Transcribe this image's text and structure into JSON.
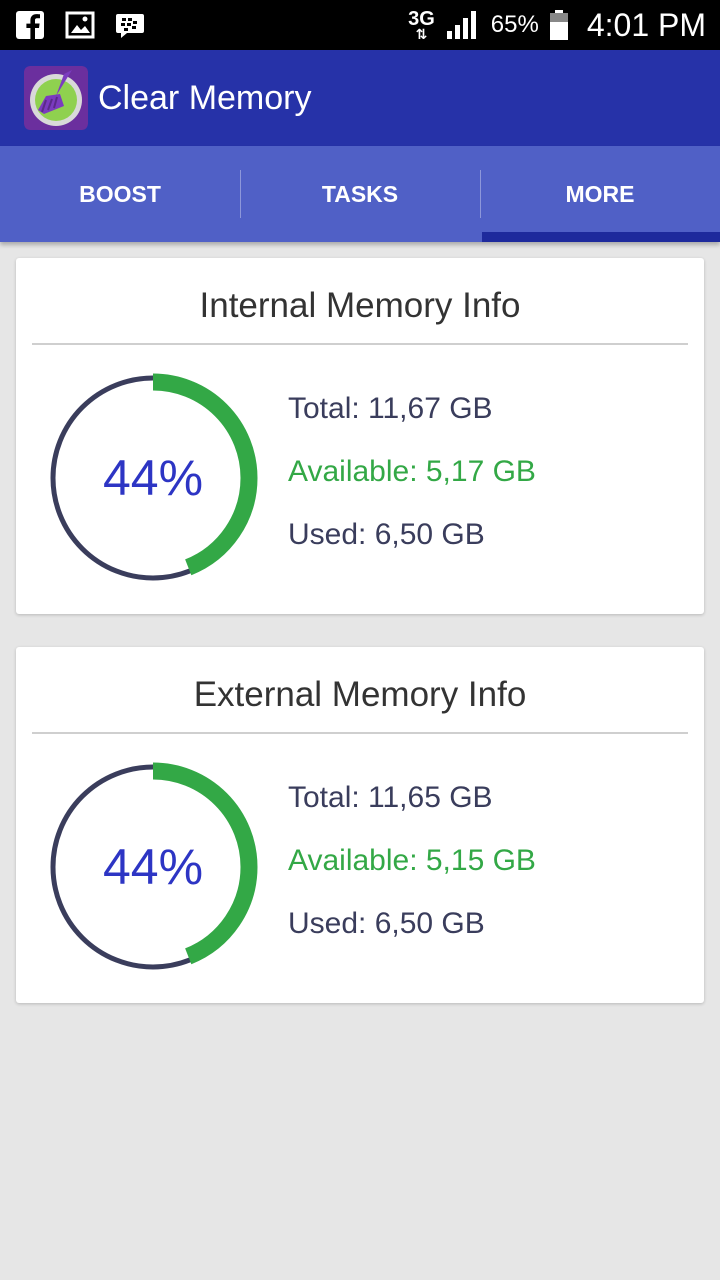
{
  "status_bar": {
    "network_type": "3G",
    "battery_percent": "65%",
    "time": "4:01 PM",
    "icons": [
      "facebook-icon",
      "gallery-icon",
      "bbm-icon",
      "data-arrows-icon",
      "signal-icon",
      "battery-icon"
    ]
  },
  "app": {
    "title": "Clear Memory",
    "logo_icon": "broom-icon"
  },
  "tabs": [
    {
      "label": "BOOST",
      "active": false
    },
    {
      "label": "TASKS",
      "active": false
    },
    {
      "label": "MORE",
      "active": true
    }
  ],
  "internal": {
    "title": "Internal Memory Info",
    "percent_label": "44%",
    "used_fraction": 0.44,
    "total": "Total: 11,67 GB",
    "available": "Available: 5,17 GB",
    "used": "Used: 6,50 GB"
  },
  "external": {
    "title": "External Memory Info",
    "percent_label": "44%",
    "used_fraction": 0.44,
    "total": "Total: 11,65 GB",
    "available": "Available: 5,15 GB",
    "used": "Used: 6,50 GB"
  },
  "colors": {
    "app_bar": "#2632a8",
    "tab_bar": "#5060c6",
    "gauge_used": "#33a846",
    "gauge_track": "#3a3d5c",
    "percent_text": "#2d35c4",
    "available_text": "#33a846"
  }
}
